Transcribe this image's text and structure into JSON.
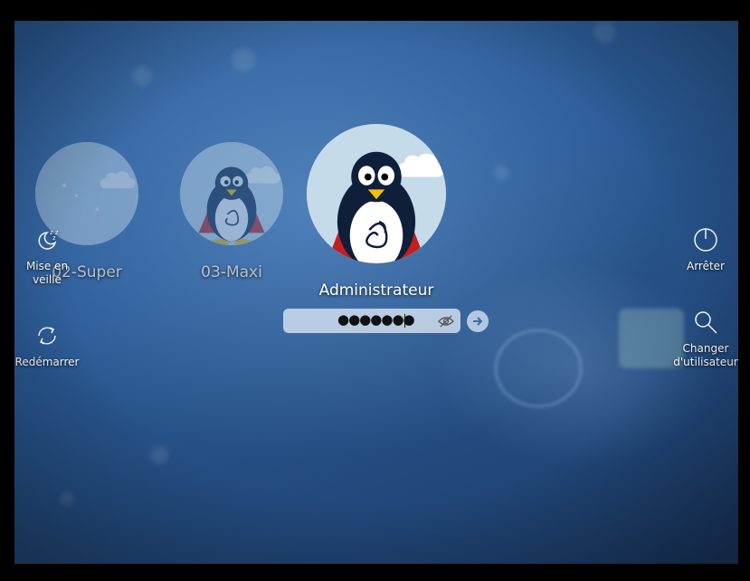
{
  "users": [
    {
      "name": "02-Super",
      "selected": false
    },
    {
      "name": "03-Maxi",
      "selected": false
    },
    {
      "name": "Administrateur",
      "selected": true
    }
  ],
  "password": {
    "masked_value": "●●●●●●●",
    "show_icon": "eye-slash-icon"
  },
  "login_icon": "arrow-right-icon",
  "actions": {
    "sleep": {
      "label": "Mise en veille",
      "icon": "moon-zzz-icon"
    },
    "restart": {
      "label": "Redémarrer",
      "icon": "restart-icon"
    },
    "shutdown": {
      "label": "Arrêter",
      "icon": "power-icon"
    },
    "switch_user": {
      "label": "Changer d'utilisateur",
      "icon": "search-icon"
    }
  },
  "colors": {
    "avatar_bg": "#c6dbea",
    "background": "#2a5a95"
  }
}
